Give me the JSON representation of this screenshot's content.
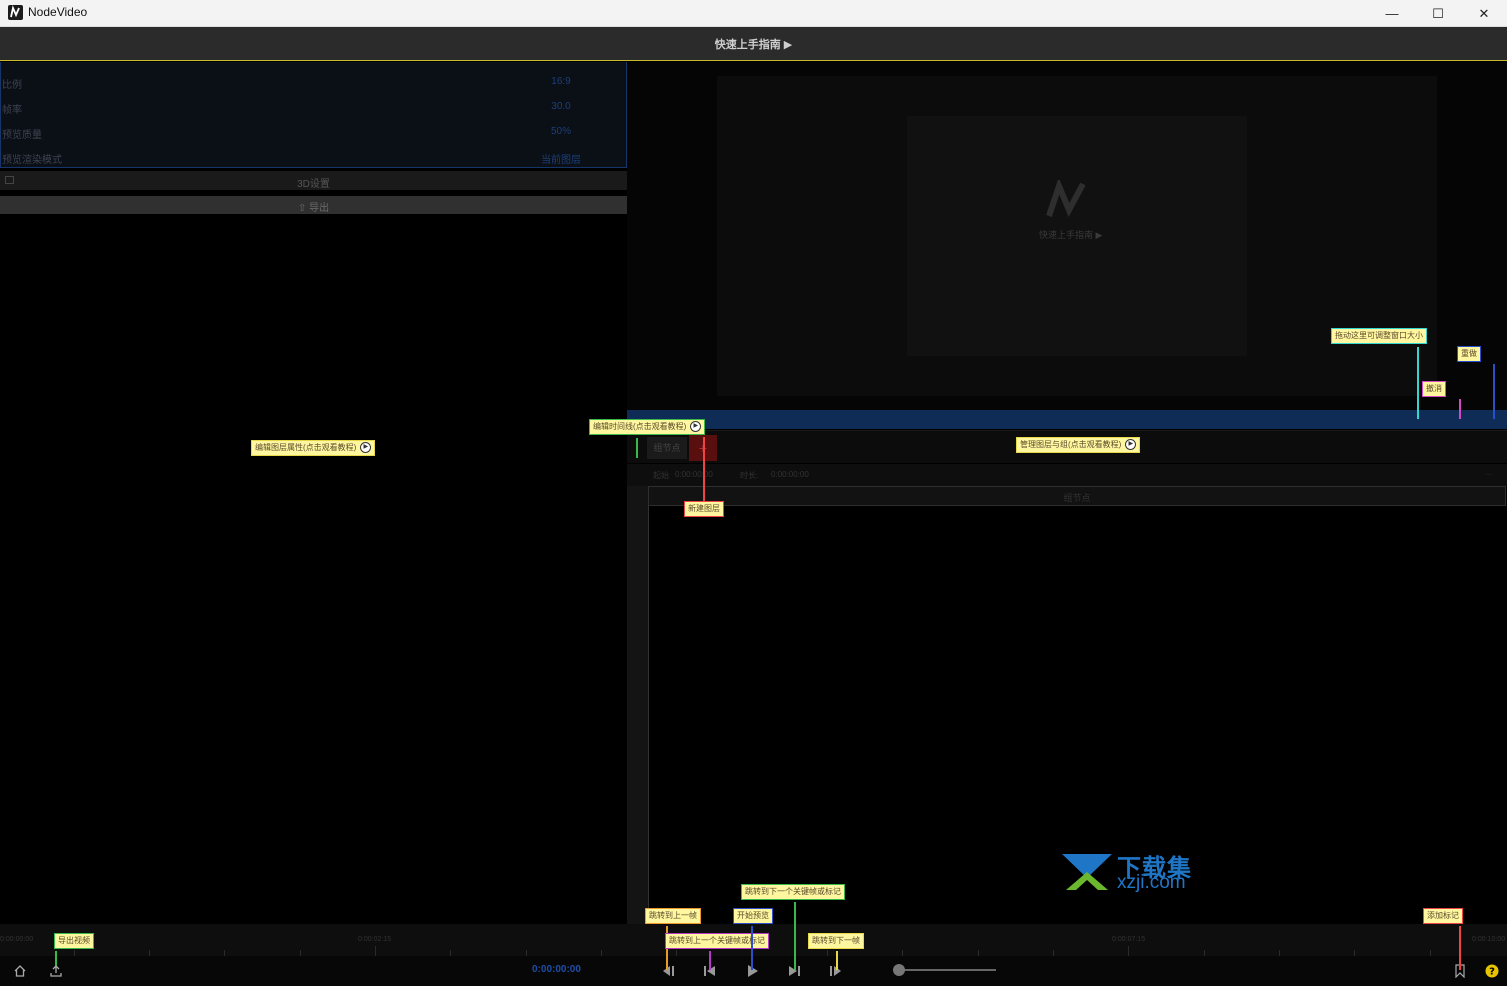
{
  "window": {
    "title": "NodeVideo",
    "minimize": "—",
    "maximize": "☐",
    "close": "✕"
  },
  "guide": {
    "label": "快速上手指南 ▶"
  },
  "properties": {
    "rows": [
      {
        "label": "比例",
        "value": "16:9"
      },
      {
        "label": "帧率",
        "value": "30.0"
      },
      {
        "label": "预览质量",
        "value": "50%"
      },
      {
        "label": "预览渲染模式",
        "value": "当前图层"
      }
    ],
    "settings_3d": "3D设置",
    "export": "导出"
  },
  "preview": {
    "guide": "快速上手指南 ▶"
  },
  "layers": {
    "node_tab": "组节点",
    "add": "+",
    "start_label": "起始",
    "start_value": "0:00:00:00",
    "duration_label": "时长:",
    "duration_value": "0:00:00:00",
    "more": "···",
    "group_node": "组节点"
  },
  "timeline": {
    "labels": [
      "0:00:00:00",
      "0:00:02:15",
      "0:00:07:15",
      "0:00:10:00"
    ],
    "timecode": "0:00:00:00"
  },
  "callouts": {
    "edit_layer_props": "编辑图层属性(点击观看教程)",
    "edit_timeline": "编辑时间线(点击观看教程)",
    "manage_layers": "管理图层与组(点击观看教程)",
    "new_layer": "新建图层",
    "resize_window": "拖动这里可调整窗口大小",
    "undo": "撤消",
    "redo": "重做",
    "export_video": "导出视频",
    "prev_frame": "跳转到上一帧",
    "prev_key": "跳转到上一个关键帧或标记",
    "start_preview": "开始预览",
    "next_key": "跳转到下一个关键帧或标记",
    "next_frame": "跳转到下一帧",
    "add_marker": "添加标记",
    "play_glyph": "▶"
  },
  "watermark": {
    "title": "下载集",
    "url": "xzji.com"
  },
  "colors": {
    "accent_blue": "#1d4ea8",
    "guide_border": "#c6bd2a",
    "callout_bg": "#fff6a0",
    "watermark": "#1f76c7"
  },
  "icons": [
    "home-icon",
    "export-icon",
    "prev-frame-icon",
    "prev-key-icon",
    "play-icon",
    "next-key-icon",
    "next-frame-icon",
    "marker-icon",
    "help-icon",
    "folder-icon",
    "upload-icon"
  ]
}
